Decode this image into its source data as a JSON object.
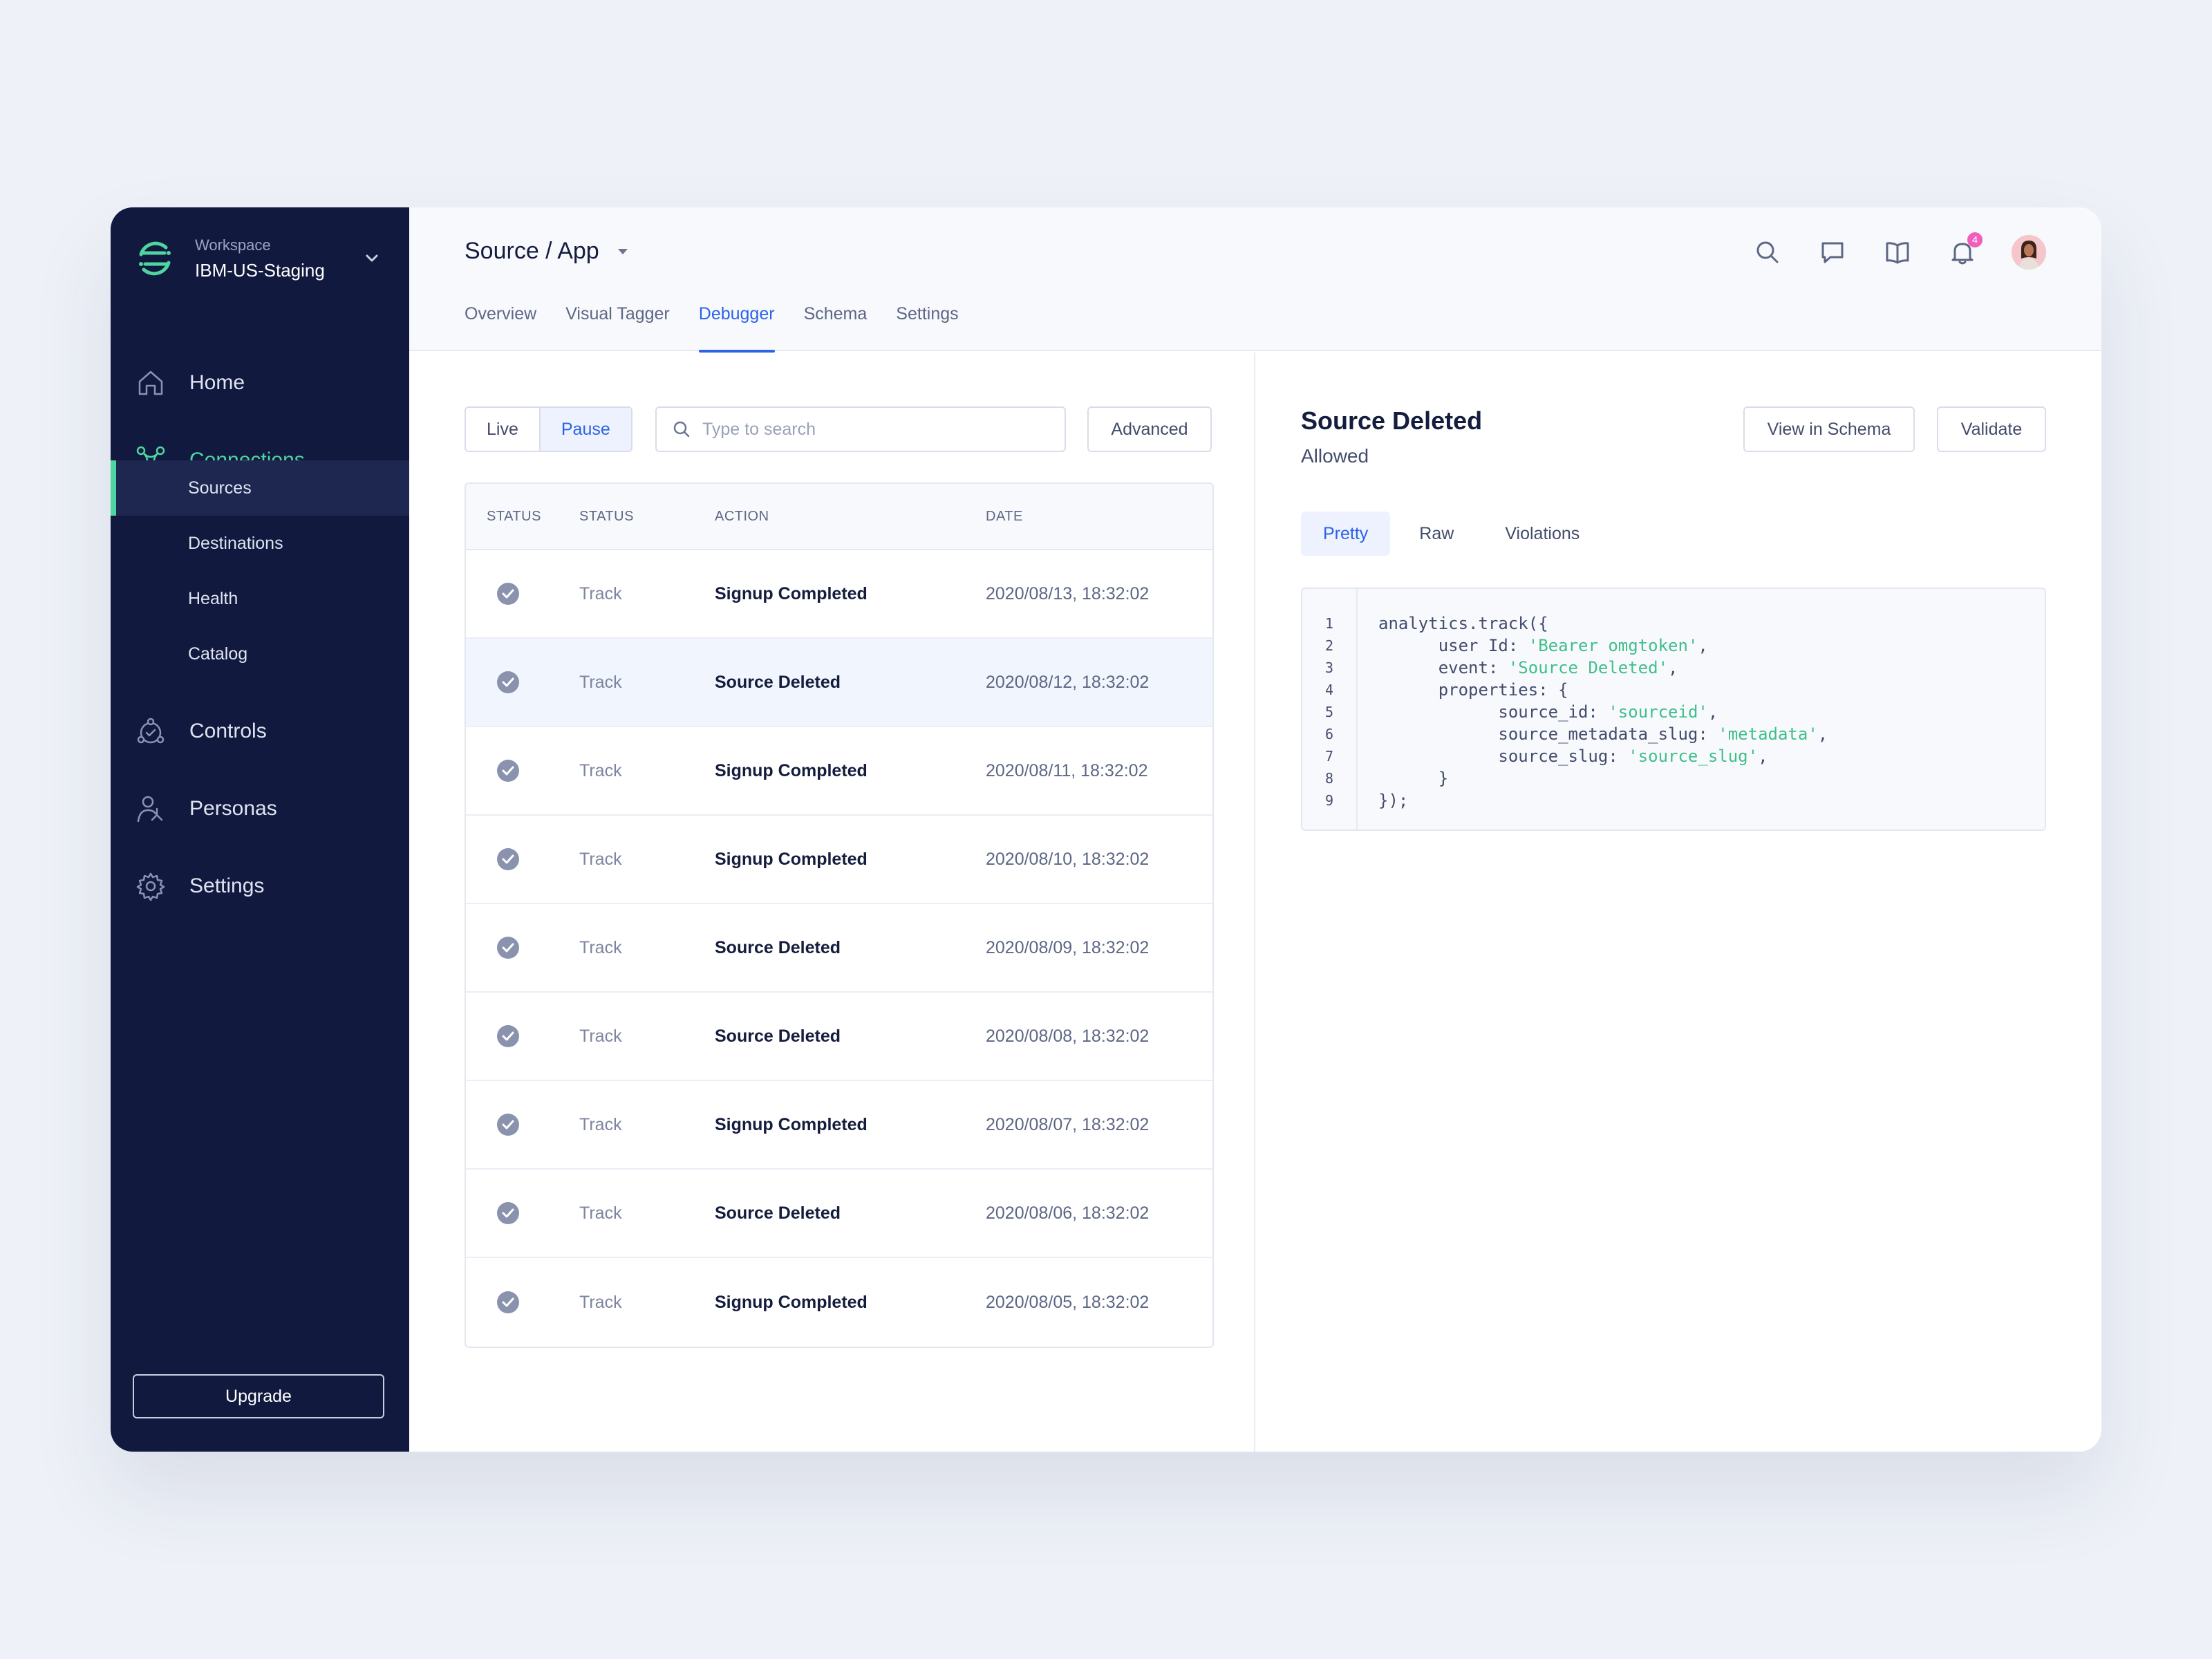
{
  "workspace": {
    "label": "Workspace",
    "name": "IBM-US-Staging"
  },
  "sidebar": {
    "nav": [
      {
        "label": "Home",
        "icon": "home-icon"
      },
      {
        "label": "Connections",
        "icon": "connections-icon",
        "active": true
      },
      {
        "label": "Controls",
        "icon": "controls-icon"
      },
      {
        "label": "Personas",
        "icon": "personas-icon"
      },
      {
        "label": "Settings",
        "icon": "gear-icon"
      }
    ],
    "sub": [
      {
        "label": "Sources",
        "selected": true
      },
      {
        "label": "Destinations"
      },
      {
        "label": "Health"
      },
      {
        "label": "Catalog"
      }
    ],
    "upgrade": "Upgrade"
  },
  "header": {
    "breadcrumb": "Source / App",
    "tabs": [
      "Overview",
      "Visual Tagger",
      "Debugger",
      "Schema",
      "Settings"
    ],
    "active_tab": "Debugger",
    "notification_count": "4"
  },
  "debugger": {
    "live": "Live",
    "pause": "Pause",
    "search_placeholder": "Type to search",
    "advanced": "Advanced",
    "columns": [
      "STATUS",
      "STATUS",
      "ACTION",
      "DATE"
    ],
    "rows": [
      {
        "type": "Track",
        "action": "Signup Completed",
        "date": "2020/08/13, 18:32:02"
      },
      {
        "type": "Track",
        "action": "Source Deleted",
        "date": "2020/08/12, 18:32:02",
        "selected": true
      },
      {
        "type": "Track",
        "action": "Signup Completed",
        "date": "2020/08/11, 18:32:02"
      },
      {
        "type": "Track",
        "action": "Signup Completed",
        "date": "2020/08/10, 18:32:02"
      },
      {
        "type": "Track",
        "action": "Source Deleted",
        "date": "2020/08/09, 18:32:02"
      },
      {
        "type": "Track",
        "action": "Source Deleted",
        "date": "2020/08/08, 18:32:02"
      },
      {
        "type": "Track",
        "action": "Signup Completed",
        "date": "2020/08/07, 18:32:02"
      },
      {
        "type": "Track",
        "action": "Source Deleted",
        "date": "2020/08/06, 18:32:02"
      },
      {
        "type": "Track",
        "action": "Signup Completed",
        "date": "2020/08/05, 18:32:02"
      }
    ]
  },
  "detail": {
    "title": "Source Deleted",
    "status": "Allowed",
    "view_schema": "View in Schema",
    "validate": "Validate",
    "tabs": [
      "Pretty",
      "Raw",
      "Violations"
    ],
    "active_tab": "Pretty",
    "line_numbers": [
      "1",
      "2",
      "3",
      "4",
      "5",
      "6",
      "7",
      "8",
      "9"
    ],
    "code": [
      [
        {
          "t": "analytics.track({"
        }
      ],
      [
        {
          "t": "      user Id: "
        },
        {
          "t": "'Bearer omgtoken'",
          "s": 1
        },
        {
          "t": ","
        }
      ],
      [
        {
          "t": "      event: "
        },
        {
          "t": "'Source Deleted'",
          "s": 1
        },
        {
          "t": ","
        }
      ],
      [
        {
          "t": "      properties: {"
        }
      ],
      [
        {
          "t": "            source_id: "
        },
        {
          "t": "'sourceid'",
          "s": 1
        },
        {
          "t": ","
        }
      ],
      [
        {
          "t": "            source_metadata_slug: "
        },
        {
          "t": "'metadata'",
          "s": 1
        },
        {
          "t": ","
        }
      ],
      [
        {
          "t": "            source_slug: "
        },
        {
          "t": "'source_slug'",
          "s": 1
        },
        {
          "t": ","
        }
      ],
      [
        {
          "t": "      }"
        }
      ],
      [
        {
          "t": "});"
        }
      ]
    ]
  },
  "colors": {
    "sidebar_bg": "#111a3e",
    "accent_green": "#4fd6a0",
    "accent_blue": "#2c63e6",
    "badge_pink": "#f05dba"
  }
}
